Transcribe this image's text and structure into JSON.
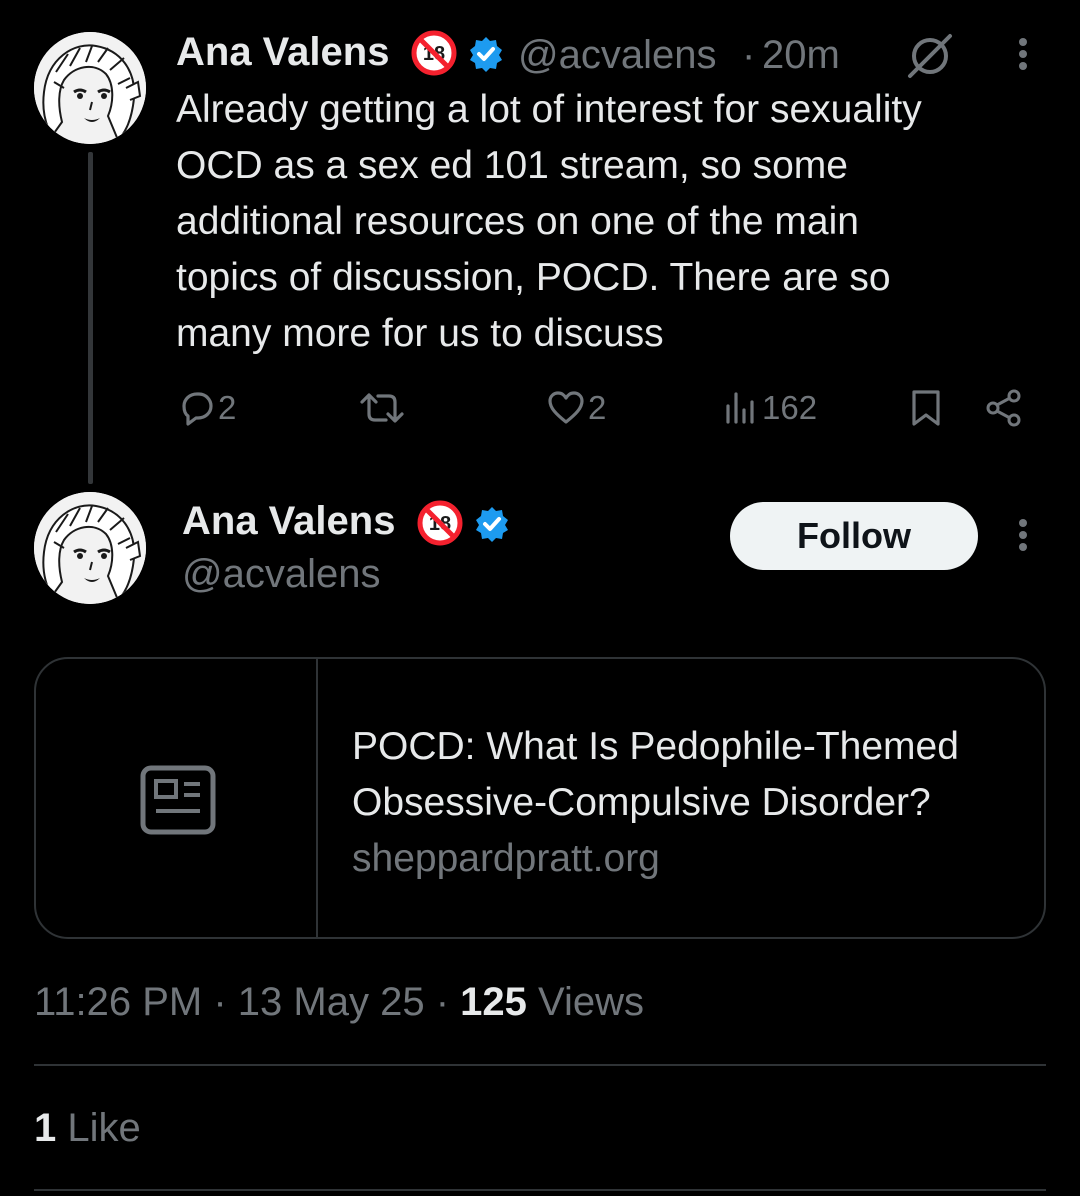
{
  "tweet": {
    "author_name": "Ana Valens",
    "handle": "@acvalens",
    "separator": "·",
    "time_ago": "20m",
    "text": "Already getting a lot of interest for sexuality\nOCD as a sex ed 101 stream, so some\nadditional resources on one of the main\ntopics of discussion, POCD. There are so\nmany more for us to discuss",
    "actions": {
      "replies": "2",
      "retweets": "",
      "likes": "2",
      "views": "162"
    }
  },
  "reply": {
    "author_name": "Ana Valens",
    "handle": "@acvalens",
    "follow_label": "Follow",
    "card": {
      "title": "POCD: What Is Pedophile-Themed Obsessive-Compulsive Disorder?",
      "domain": "sheppardpratt.org"
    },
    "time": "11:26 PM",
    "sep1": " · ",
    "date": "13 May 25",
    "sep2": " · ",
    "views_count": "125",
    "views_label": " Views",
    "likes_count": "1",
    "likes_label": " Like"
  },
  "colors": {
    "background": "#000000",
    "text": "#e7e9ea",
    "muted": "#71767b",
    "verified": "#1d9bf0",
    "badge18": "#f4212e",
    "border": "#2f3336"
  },
  "icons": [
    "grok-icon",
    "more-icon",
    "reply-icon",
    "retweet-icon",
    "like-icon",
    "views-icon",
    "bookmark-icon",
    "share-icon",
    "verified-icon",
    "no-under-18-icon",
    "article-icon"
  ]
}
